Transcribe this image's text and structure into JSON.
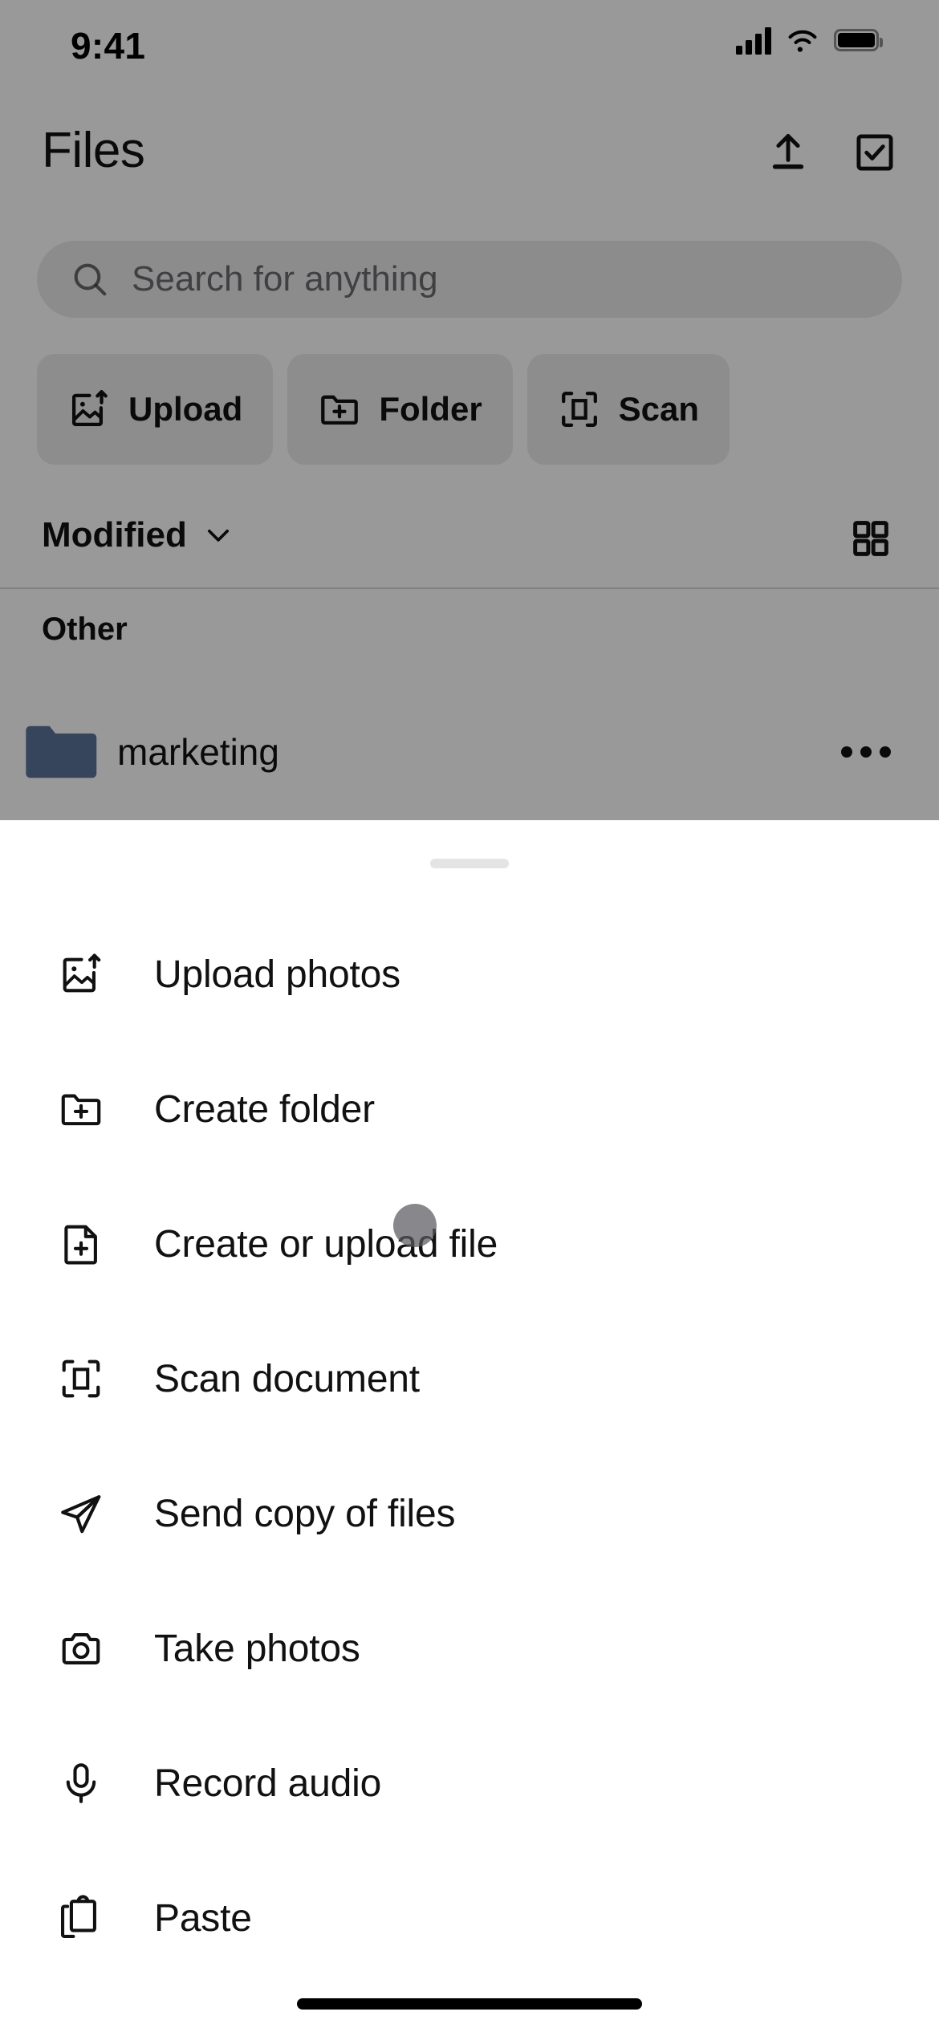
{
  "status_bar": {
    "time": "9:41",
    "signal_icon": "cellular-signal-icon",
    "wifi_icon": "wifi-icon",
    "battery_icon": "battery-icon"
  },
  "header": {
    "title": "Files",
    "upload_icon": "upload-icon",
    "select_icon": "select-checkbox-icon"
  },
  "search": {
    "placeholder": "Search for anything",
    "value": "",
    "icon": "search-icon"
  },
  "quick_actions": [
    {
      "label": "Upload",
      "icon": "image-upload-icon"
    },
    {
      "label": "Folder",
      "icon": "folder-plus-icon"
    },
    {
      "label": "Scan",
      "icon": "scan-frame-icon"
    }
  ],
  "sort_bar": {
    "sort_label": "Modified",
    "chevron_icon": "chevron-down-icon",
    "view_toggle_icon": "grid-view-icon"
  },
  "content": {
    "section_label": "Other",
    "rows": [
      {
        "name": "marketing",
        "icon": "folder-icon",
        "more_icon": "more-horizontal-icon"
      }
    ]
  },
  "sheet": {
    "grabber": "drag-handle",
    "items": [
      {
        "label": "Upload photos",
        "icon": "image-upload-icon"
      },
      {
        "label": "Create folder",
        "icon": "folder-plus-icon"
      },
      {
        "label": "Create or upload file",
        "icon": "file-plus-icon"
      },
      {
        "label": "Scan document",
        "icon": "scan-frame-icon"
      },
      {
        "label": "Send copy of files",
        "icon": "send-paper-plane-icon"
      },
      {
        "label": "Take photos",
        "icon": "camera-icon"
      },
      {
        "label": "Record audio",
        "icon": "microphone-icon"
      },
      {
        "label": "Paste",
        "icon": "clipboard-paste-icon"
      }
    ]
  },
  "colors": {
    "folder_blue": "#5d7399",
    "scrim": "rgba(0,0,0,0.40)",
    "text_primary": "#111111"
  },
  "system": {
    "home_indicator": "home-indicator"
  }
}
